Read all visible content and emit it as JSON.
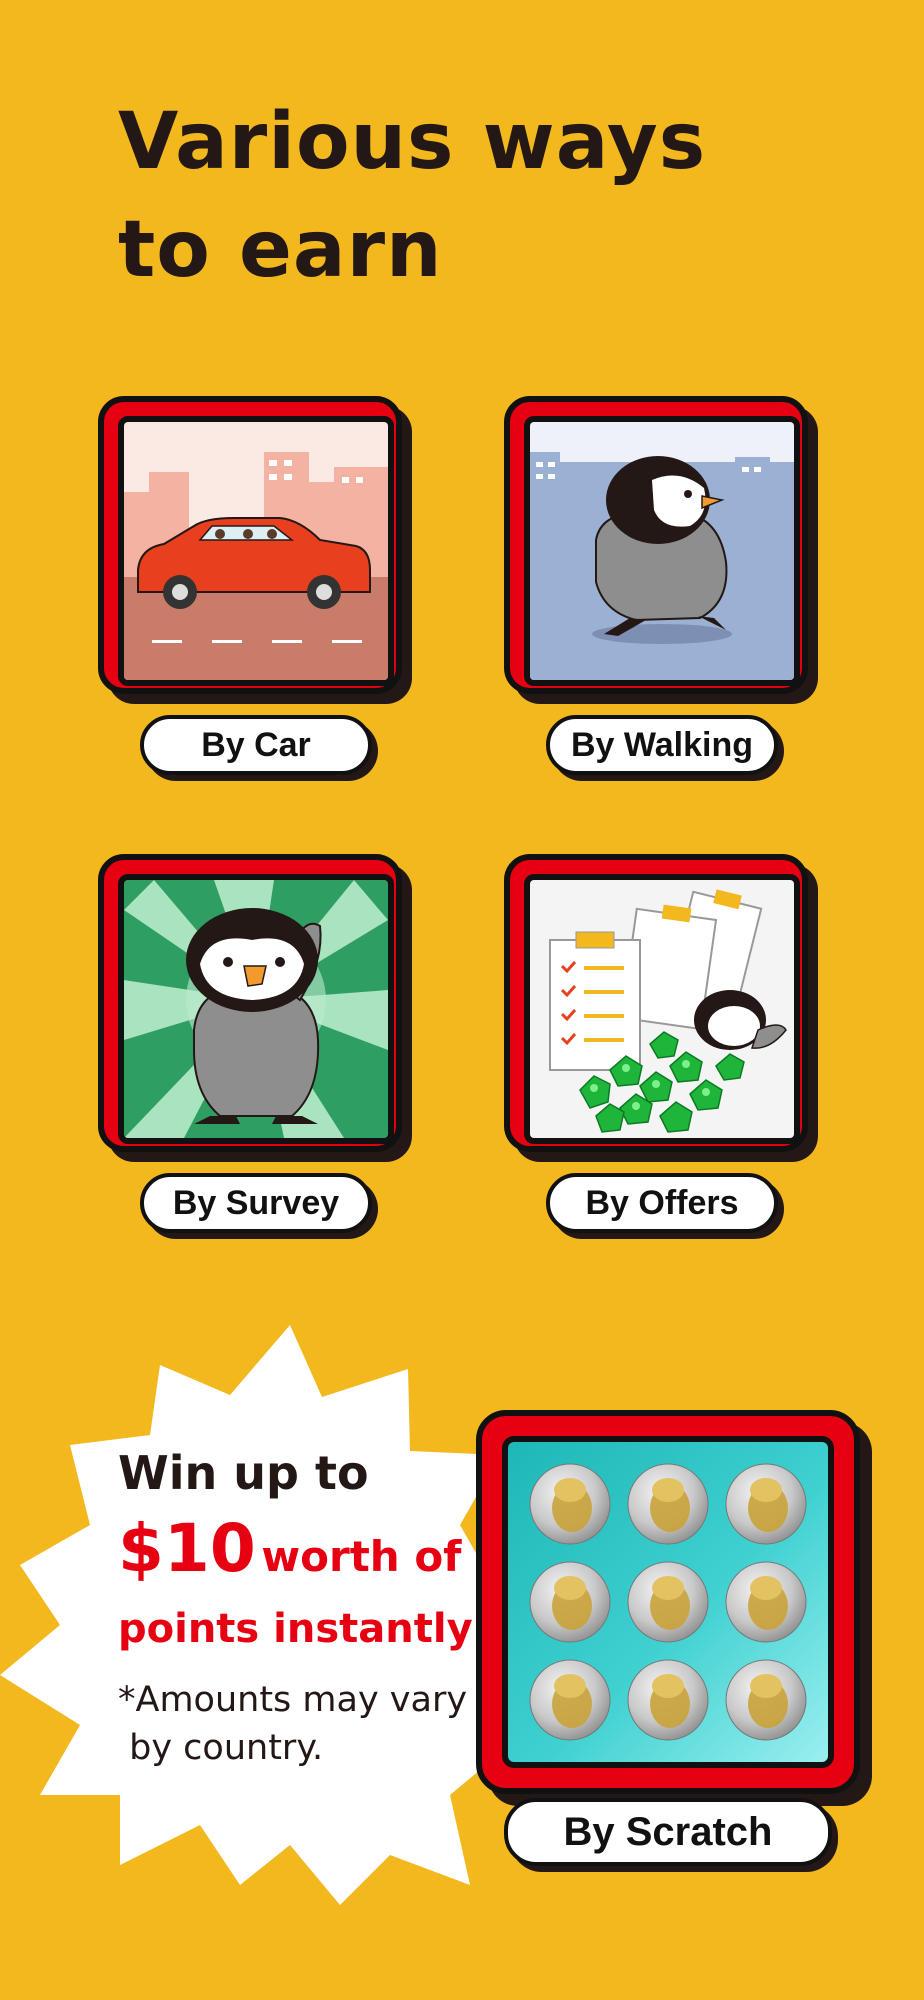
{
  "title": {
    "line1": "Various ways",
    "line2": "to earn"
  },
  "methods": [
    {
      "label": "By Car"
    },
    {
      "label": "By Walking"
    },
    {
      "label": "By Survey"
    },
    {
      "label": "By Offers"
    }
  ],
  "promo": {
    "line1": "Win up to",
    "amount": "$10",
    "amount_suffix": "worth of",
    "line3": "points instantly!",
    "note_line1": "*Amounts may vary",
    "note_line2": " by country."
  },
  "scratch": {
    "label": "By Scratch"
  },
  "colors": {
    "background": "#F2B81E",
    "frame_red": "#E60012",
    "text_dark": "#231815"
  }
}
